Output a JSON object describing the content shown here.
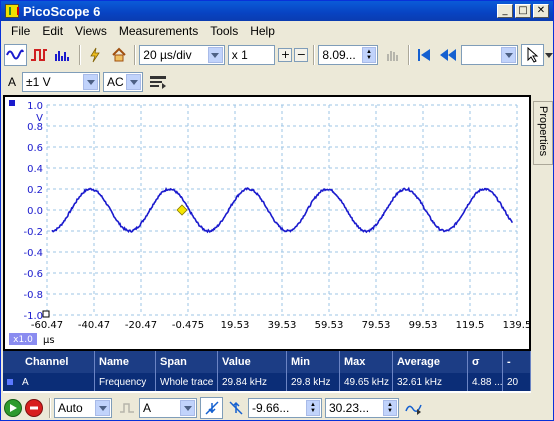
{
  "window": {
    "title": "PicoScope 6"
  },
  "menu": [
    "File",
    "Edit",
    "Views",
    "Measurements",
    "Tools",
    "Help"
  ],
  "toolbar": {
    "timebase": "20 µs/div",
    "zoom": "x 1",
    "samples": "8.09..."
  },
  "channel": {
    "name": "A",
    "range": "±1 V",
    "coupling": "AC"
  },
  "side_tab": "Properties",
  "scope": {
    "y_unit": "V",
    "x_unit": "µs",
    "zoom_badge": "x1.0",
    "y_ticks": [
      "1.0",
      "0.8",
      "0.6",
      "0.4",
      "0.2",
      "0.0",
      "-0.2",
      "-0.4",
      "-0.6",
      "-0.8",
      "-1.0"
    ],
    "x_ticks": [
      "-60.47",
      "-40.47",
      "-20.47",
      "-0.475",
      "19.53",
      "39.53",
      "59.53",
      "79.53",
      "99.53",
      "119.5",
      "139.5"
    ],
    "trace_color": "#1a1acd",
    "trigger_color": "#f5e600"
  },
  "measurements": {
    "headers": [
      "Channel",
      "Name",
      "Span",
      "Value",
      "Min",
      "Max",
      "Average",
      "σ",
      "-"
    ],
    "rows": [
      [
        "A",
        "Frequency",
        "Whole trace",
        "29.84 kHz",
        "29.8 kHz",
        "49.65 kHz",
        "32.61 kHz",
        "4.88 ...",
        "20"
      ]
    ]
  },
  "bottom": {
    "trigger_mode": "Auto",
    "trigger_channel": "A",
    "threshold": "-9.66...",
    "pretrigger": "30.23..."
  }
}
